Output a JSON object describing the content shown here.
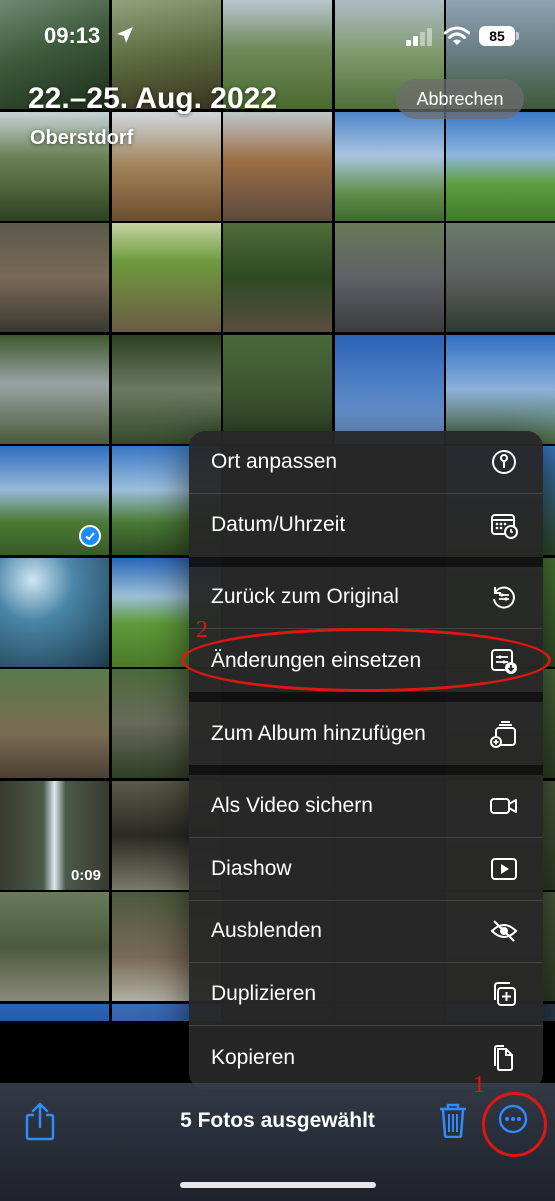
{
  "status_bar": {
    "time": "09:13",
    "battery": "85"
  },
  "header": {
    "title": "22.–25. Aug. 2022",
    "subtitle": "Oberstdorf",
    "cancel_label": "Abbrechen"
  },
  "video_duration": "0:09",
  "menu": {
    "items": [
      {
        "label": "Ort anpassen",
        "icon": "info-pin-icon"
      },
      {
        "label": "Datum/Uhrzeit",
        "icon": "calendar-clock-icon"
      },
      {
        "label": "Zurück zum Original",
        "icon": "revert-icon"
      },
      {
        "label": "Änderungen einsetzen",
        "icon": "paste-edits-icon"
      },
      {
        "label": "Zum Album hinzufügen",
        "icon": "add-album-icon"
      },
      {
        "label": "Als Video sichern",
        "icon": "video-icon"
      },
      {
        "label": "Diashow",
        "icon": "play-icon"
      },
      {
        "label": "Ausblenden",
        "icon": "eye-slash-icon"
      },
      {
        "label": "Duplizieren",
        "icon": "duplicate-icon"
      },
      {
        "label": "Kopieren",
        "icon": "copy-icon"
      }
    ]
  },
  "toolbar": {
    "selection_label": "5 Fotos ausgewählt"
  },
  "annotations": {
    "step1": "1",
    "step2": "2",
    "color": "#e0170f"
  },
  "accent_color": "#1a8cff"
}
